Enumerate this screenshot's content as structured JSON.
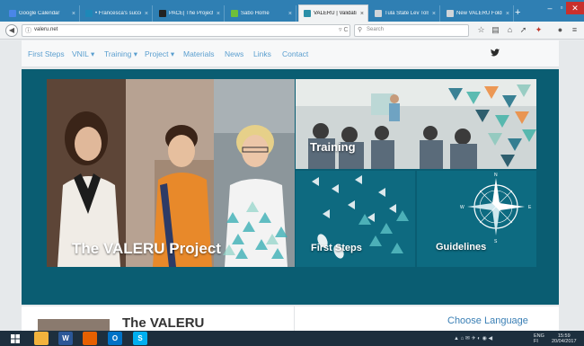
{
  "browser": {
    "tabs": [
      {
        "title": "Google Calendar",
        "favicon_color": "#4a86e8",
        "active": false
      },
      {
        "title": "• Francesca's succe...",
        "favicon_color": "#1e88b8",
        "active": false
      },
      {
        "title": "PACE| The Project...",
        "favicon_color": "#222222",
        "active": false
      },
      {
        "title": "Sabo Home",
        "favicon_color": "#6fbf3a",
        "active": false
      },
      {
        "title": "VALERU | Validation of ...",
        "favicon_color": "#2a8fa8",
        "active": true
      },
      {
        "title": "Tula State Lev Tolstoy ...",
        "favicon_color": "#d0d4d8",
        "active": false
      },
      {
        "title": "New VALERU Folder | V...",
        "favicon_color": "#d0d4d8",
        "active": false
      }
    ],
    "tab_close_glyph": "×",
    "new_tab_glyph": "+",
    "window_controls": {
      "minimize": "–",
      "maximize": "▫",
      "close": "✕"
    },
    "url": "valeru.net",
    "reload_glyph": "▿ C",
    "search_placeholder": "Search"
  },
  "site": {
    "nav_links": [
      "First Steps",
      "VNIL ▾",
      "Training ▾",
      "Project ▾",
      "Materials",
      "News",
      "Links",
      "Contact"
    ],
    "twitter_icon": "twitter-icon",
    "hero_panels": {
      "project": "The VALERU Project",
      "training": "Training",
      "first_steps": "First Steps",
      "guidelines": "Guidelines"
    },
    "compass_letters": {
      "n": "N",
      "s": "S",
      "e": "E",
      "w": "W"
    },
    "below_title": "The VALERU",
    "choose_language": "Choose Language"
  },
  "taskbar": {
    "apps": [
      {
        "name": "file-explorer",
        "color": "#f2b33d",
        "glyph": ""
      },
      {
        "name": "word",
        "color": "#2b5797",
        "glyph": "W"
      },
      {
        "name": "firefox",
        "color": "#e66000",
        "glyph": ""
      },
      {
        "name": "outlook",
        "color": "#0072c6",
        "glyph": "O"
      },
      {
        "name": "skype",
        "color": "#00aff0",
        "glyph": "S"
      }
    ],
    "tray_icons": "▲ ⌂ ✉ ✈ ◐ ◉ ◀",
    "lang": "ENG",
    "lang_region": "FI",
    "time": "15:59",
    "date": "20/04/2017"
  },
  "colors": {
    "hero_bg": "#0a5d72",
    "nav_link": "#5a9ecf",
    "tab_strip": "#2f7fb3",
    "taskbar": "#1d2f3e"
  }
}
